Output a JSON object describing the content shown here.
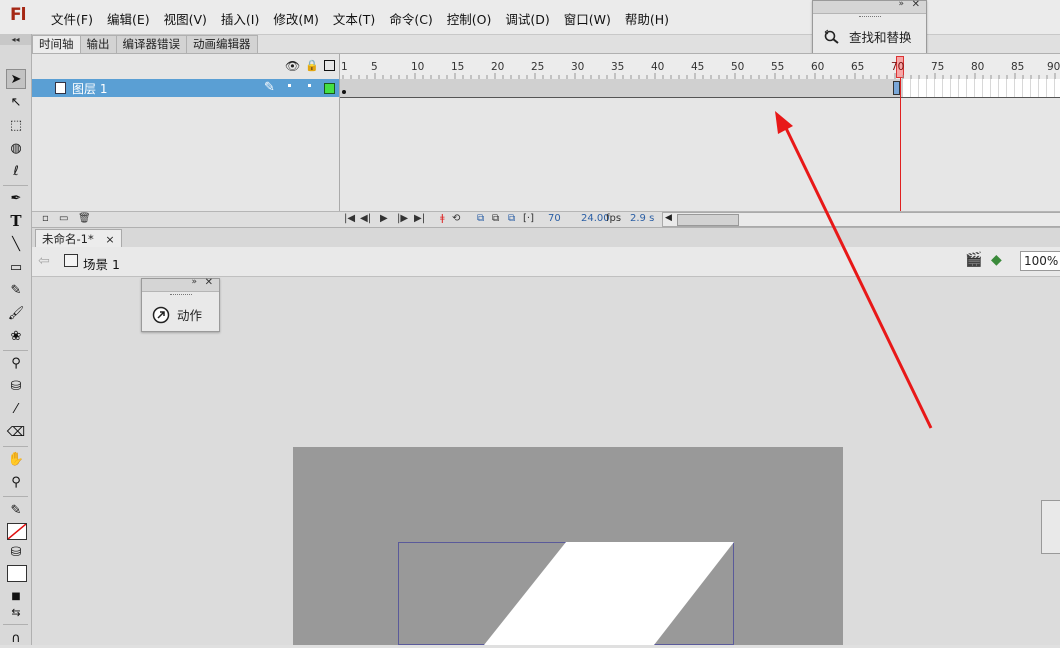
{
  "app": {
    "logo": "Fl"
  },
  "menus": [
    {
      "label": "文件(F)"
    },
    {
      "label": "编辑(E)"
    },
    {
      "label": "视图(V)"
    },
    {
      "label": "插入(I)"
    },
    {
      "label": "修改(M)"
    },
    {
      "label": "文本(T)"
    },
    {
      "label": "命令(C)"
    },
    {
      "label": "控制(O)"
    },
    {
      "label": "调试(D)"
    },
    {
      "label": "窗口(W)"
    },
    {
      "label": "帮助(H)"
    }
  ],
  "find_panel": {
    "label": "查找和替换",
    "icon": "find-replace-icon"
  },
  "actions_panel": {
    "label": "动作",
    "icon": "actions-icon"
  },
  "timeline_tabs": [
    {
      "label": "时间轴",
      "active": true
    },
    {
      "label": "输出",
      "active": false
    },
    {
      "label": "编译器错误",
      "active": false
    },
    {
      "label": "动画编辑器",
      "active": false
    }
  ],
  "timeline": {
    "layer_name": "图层 1",
    "ruler_labels": [
      "1",
      "5",
      "10",
      "15",
      "20",
      "25",
      "30",
      "35",
      "40",
      "45",
      "50",
      "55",
      "60",
      "65",
      "70",
      "75",
      "80",
      "85",
      "90"
    ],
    "current_frame_marker": "70",
    "footer": {
      "frame": "70",
      "fps": "24.00",
      "fps_unit": "fps",
      "time": "2.9 s"
    }
  },
  "document": {
    "tab_label": "未命名-1*",
    "close_glyph": "×",
    "scene_label": "场景 1",
    "zoom": "100%"
  },
  "colors": {
    "layer_highlight": "#5a9fd4",
    "playhead": "#e02020",
    "annotation_arrow": "#e81818",
    "stage_gray": "#999999"
  }
}
